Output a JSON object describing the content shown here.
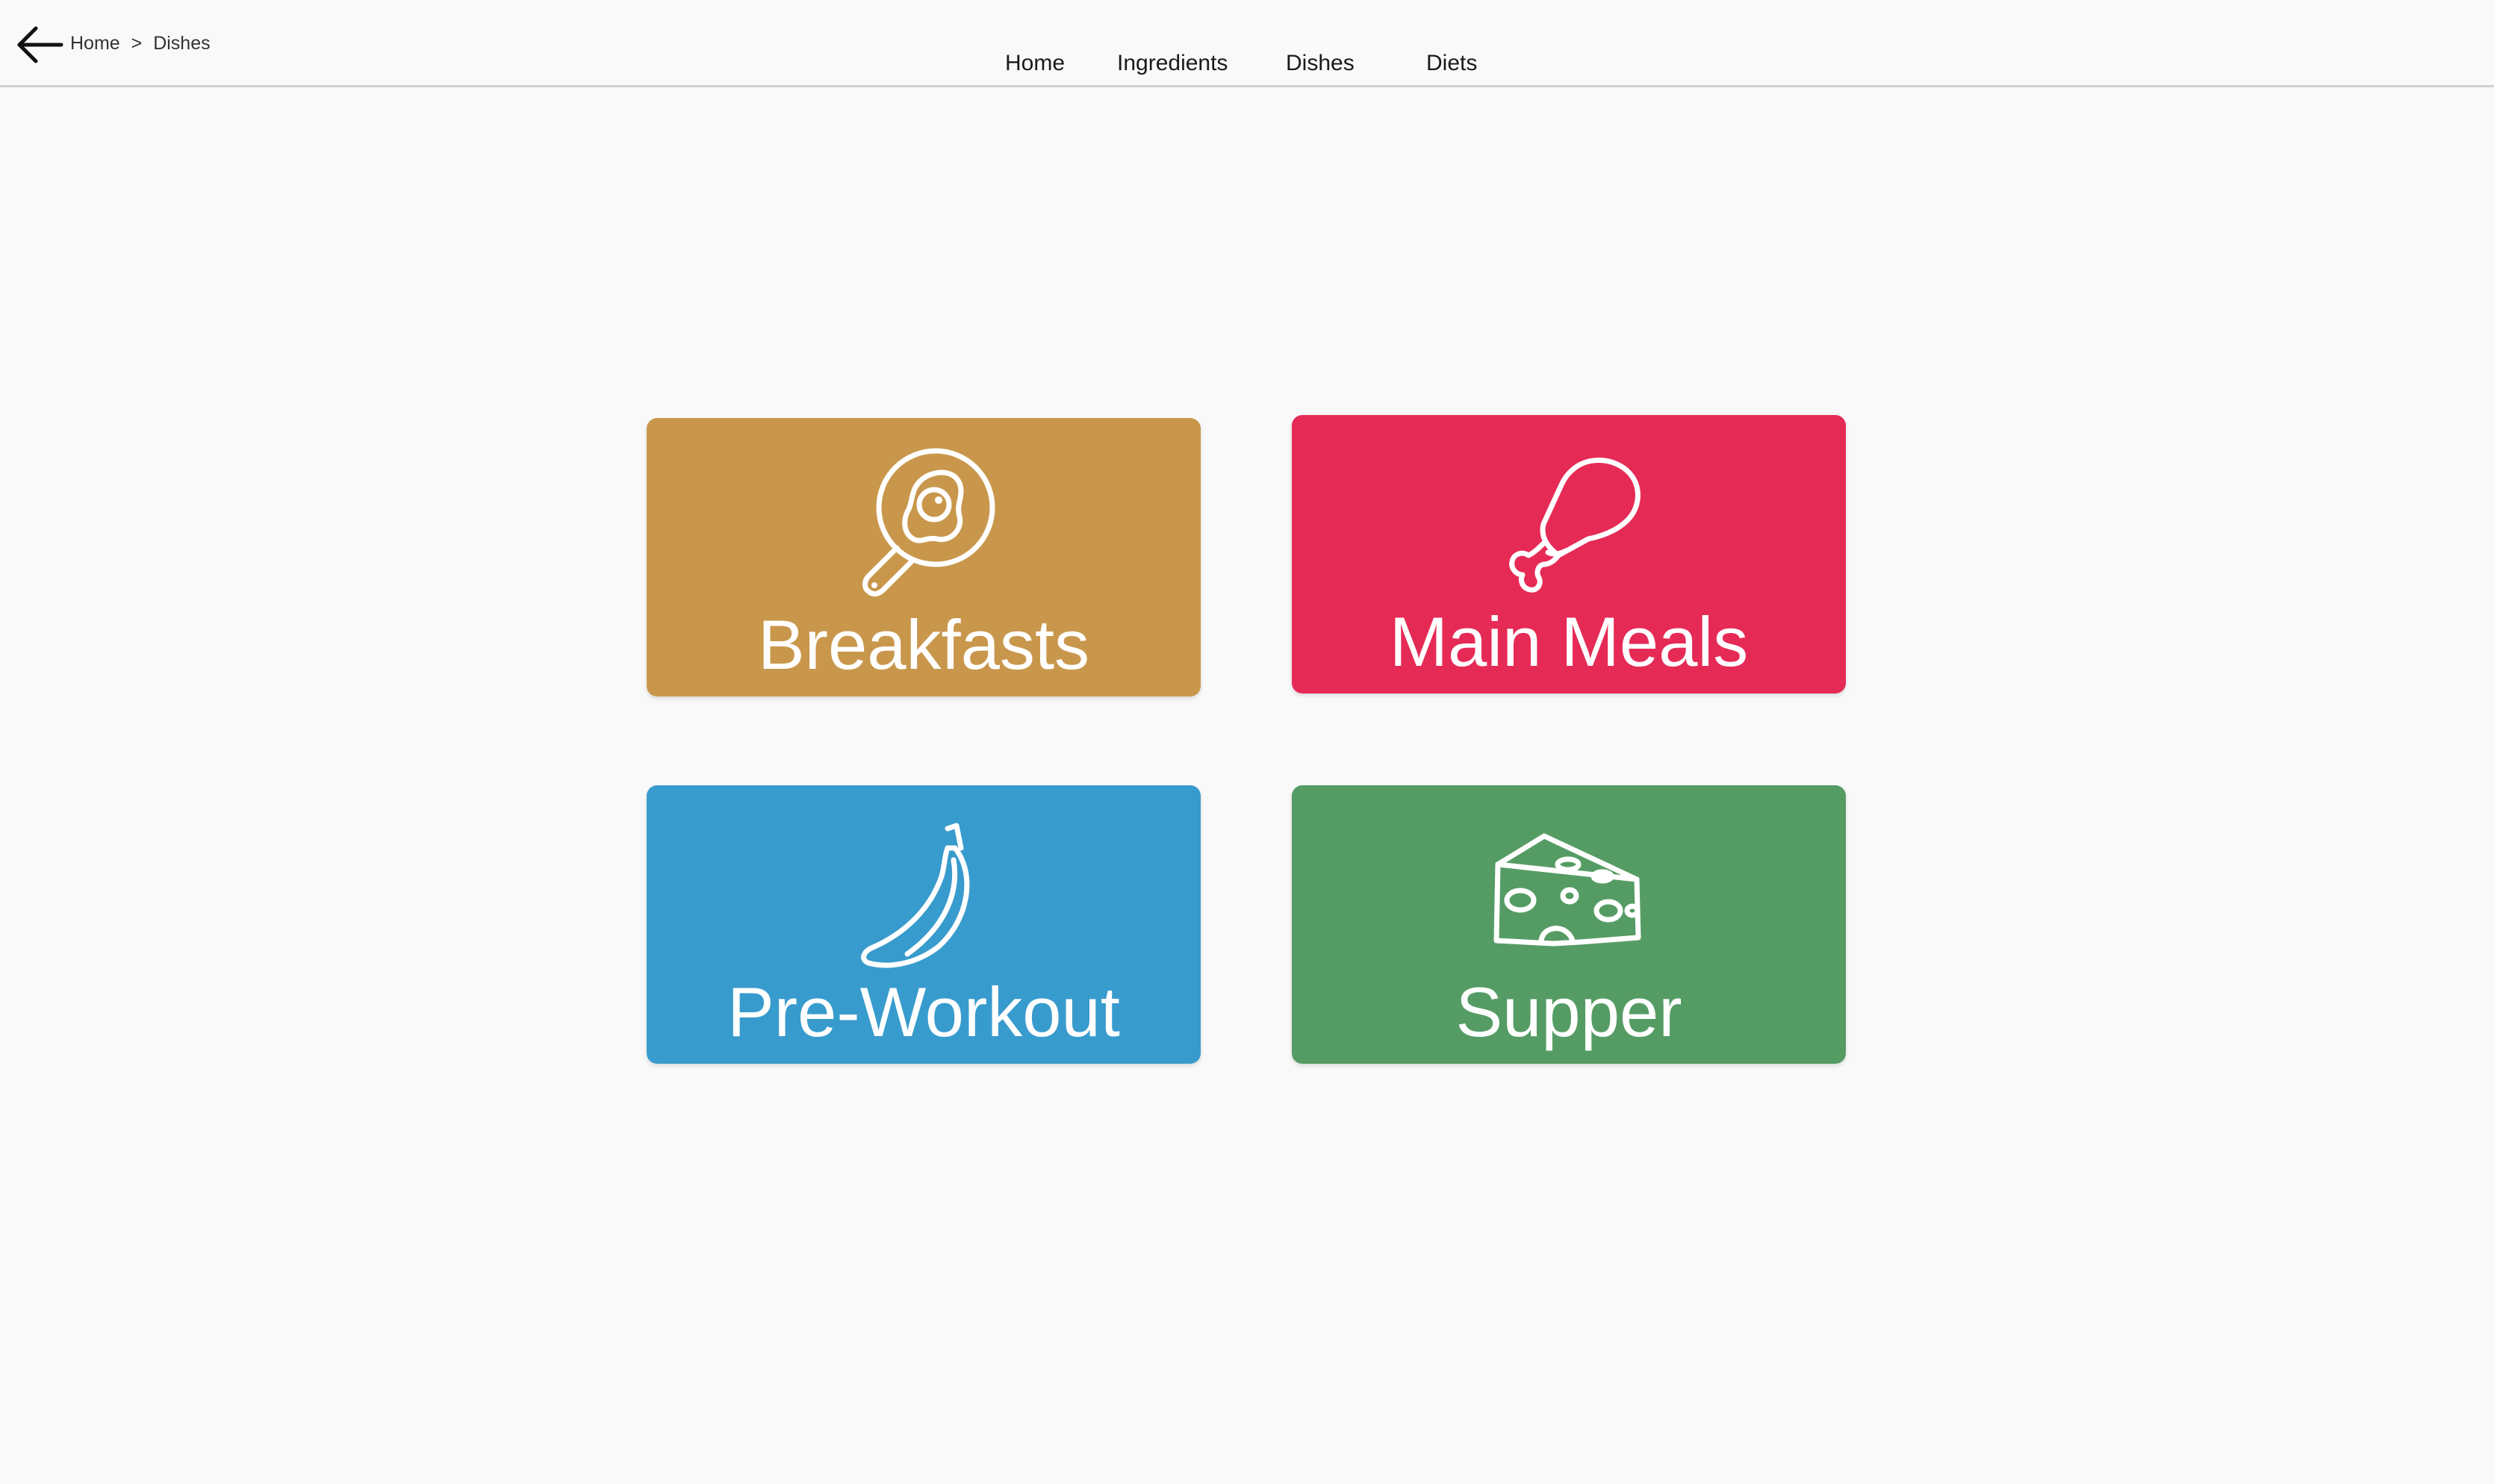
{
  "header": {
    "breadcrumb": {
      "home": "Home",
      "separator": ">",
      "current": "Dishes"
    },
    "back_icon": "arrow-left-icon",
    "nav": [
      {
        "label": "Home"
      },
      {
        "label": "Ingredients"
      },
      {
        "label": "Dishes"
      },
      {
        "label": "Diets"
      }
    ]
  },
  "categories": [
    {
      "label": "Breakfasts",
      "color": "#c9974c",
      "icon": "frying-pan-egg-icon"
    },
    {
      "label": "Main Meals",
      "color": "#e62a56",
      "icon": "chicken-leg-icon"
    },
    {
      "label": "Pre-Workout",
      "color": "#389bcd",
      "icon": "banana-icon"
    },
    {
      "label": "Supper",
      "color": "#559c64",
      "icon": "cheese-icon"
    }
  ]
}
